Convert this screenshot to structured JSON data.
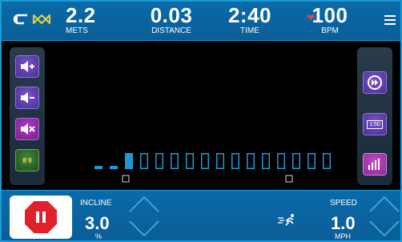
{
  "top": {
    "mets": {
      "value": "2.2",
      "label": "METS"
    },
    "distance": {
      "value": "0.03",
      "label": "DISTANCE"
    },
    "time": {
      "value": "2:40",
      "label": "TIME"
    },
    "bpm": {
      "value": "100",
      "label": "BPM"
    }
  },
  "left_panel": [
    "volume-up-icon",
    "volume-down-icon",
    "mute-icon",
    "equalizer-icon"
  ],
  "left_equalizer_text": "8 9",
  "right_panel": {
    "timer_label": "1:50",
    "icons": [
      "fast-forward-icon",
      "timer-icon",
      "bar-graph-icon"
    ]
  },
  "chart_data": {
    "type": "bar",
    "segments": 16,
    "current_index": 3,
    "values": [
      0.2,
      0.2,
      1,
      0,
      0,
      0,
      0,
      0,
      0,
      0,
      0,
      0,
      0,
      0,
      0,
      0
    ]
  },
  "incline": {
    "label": "INCLINE",
    "value": "3.0",
    "unit": "%"
  },
  "speed": {
    "label": "SPEED",
    "value": "1.0",
    "unit": "MPH"
  },
  "colors": {
    "accent": "#1b9ad6",
    "bar": "#1b9ad6",
    "pause": "#e0202a"
  }
}
